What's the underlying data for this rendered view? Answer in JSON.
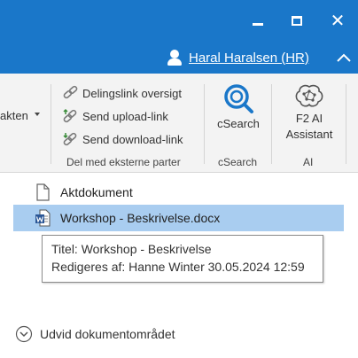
{
  "window": {
    "minimize_icon": "minimize-icon",
    "maximize_icon": "maximize-icon",
    "close_icon": "close-icon",
    "accent_color": "#1a77c9"
  },
  "user": {
    "name": "Haral Haralsen (HR)",
    "icon": "user-icon"
  },
  "ribbon": {
    "partial_button_label": "akten",
    "share_group": {
      "items": [
        {
          "label": "Delingslink oversigt",
          "icon": "link-icon"
        },
        {
          "label": "Send upload-link",
          "icon": "upload-link-icon"
        },
        {
          "label": "Send download-link",
          "icon": "download-link-icon"
        }
      ],
      "group_label": "Del med eksterne parter"
    },
    "csearch_group": {
      "button_label": "cSearch",
      "group_label": "cSearch",
      "icon": "csearch-icon"
    },
    "ai_group": {
      "button_label_line1": "F2 AI",
      "button_label_line2": "Assistant",
      "group_label": "AI",
      "icon": "ai-brain-icon"
    }
  },
  "documents": {
    "items": [
      {
        "label": "Aktdokument",
        "icon": "document-icon",
        "selected": false
      },
      {
        "label": "Workshop - Beskrivelse.docx",
        "icon": "word-document-icon",
        "selected": true
      }
    ],
    "tooltip": {
      "line1": "Titel: Workshop - Beskrivelse",
      "line2": "Redigeres af: Hanne Winter 30.05.2024 12:59"
    },
    "selection_color": "#a9cdf0",
    "expand_label": "Udvid dokumentområdet"
  }
}
